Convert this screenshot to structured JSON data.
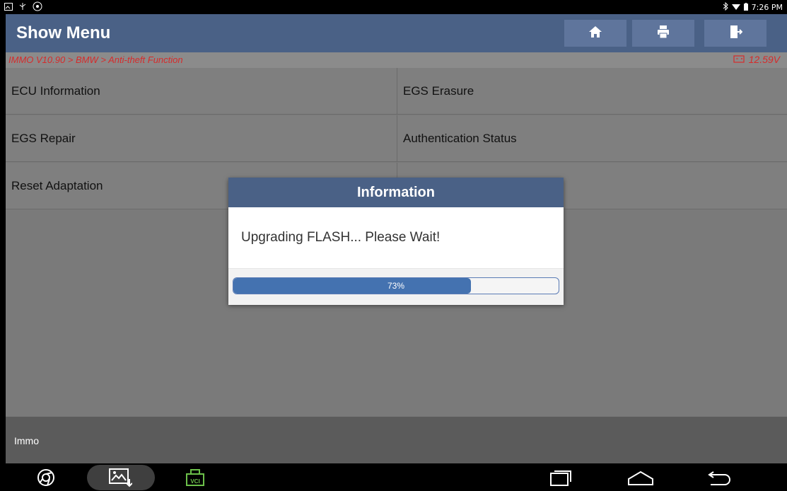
{
  "status_bar": {
    "time": "7:26 PM",
    "left_icons": [
      "gallery-icon",
      "usb-icon",
      "brightness-icon"
    ],
    "right_icons": [
      "bluetooth-icon",
      "wifi-icon",
      "battery-icon"
    ]
  },
  "header": {
    "title": "Show Menu",
    "buttons": [
      "home-icon",
      "print-icon",
      "exit-icon"
    ]
  },
  "breadcrumb": {
    "path": "IMMO V10.90 > BMW > Anti-theft Function",
    "voltage": "12.59V"
  },
  "menu": {
    "items": [
      {
        "label": "ECU Information"
      },
      {
        "label": "EGS Erasure"
      },
      {
        "label": "EGS Repair"
      },
      {
        "label": "Authentication Status"
      },
      {
        "label": "Reset Adaptation"
      },
      {
        "label": ""
      }
    ]
  },
  "footer": {
    "label": "Immo"
  },
  "dialog": {
    "title": "Information",
    "message": "Upgrading FLASH... Please Wait!",
    "progress": 0.73,
    "progress_text": "73%"
  },
  "nav_bar": {
    "vci_label": "VCI"
  },
  "colors": {
    "header": "#4a6186",
    "progress": "#4472b0",
    "breadcrumb_text": "#d62b2b"
  }
}
